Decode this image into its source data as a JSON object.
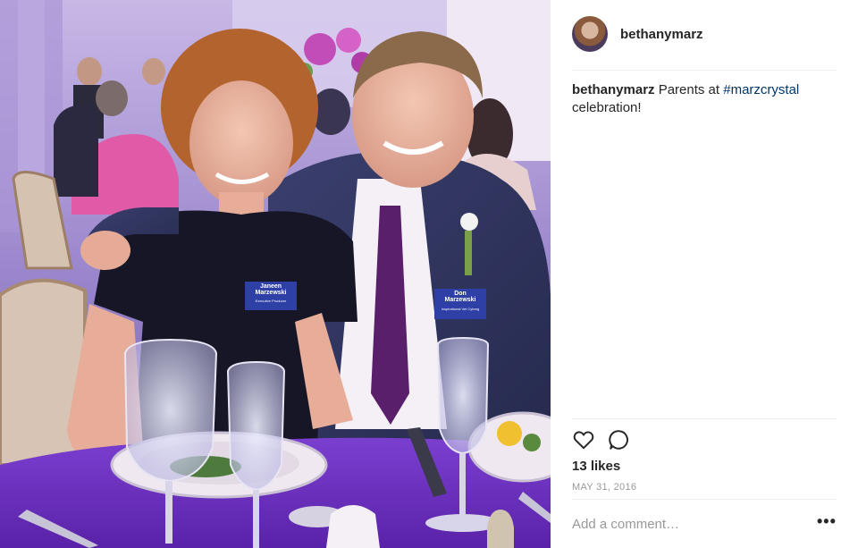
{
  "post": {
    "username": "bethanymarz",
    "caption": {
      "username": "bethanymarz",
      "text": " Parents at ",
      "hashtag": "#marzcrystal",
      "text_after": " celebration!"
    },
    "likes": "13 likes",
    "date": "MAY 31, 2016",
    "comment_placeholder": "Add a comment…",
    "more_label": "•••"
  },
  "photo": {
    "name_tag_left": {
      "line1": "Janeen",
      "line2": "Marzewski",
      "line3": "Executive Producer"
    },
    "name_tag_right": {
      "line1": "Don",
      "line2": "Marzewski",
      "line3": "Inspirational Vet Cyborg"
    }
  },
  "icons": {
    "like": "heart-icon",
    "comment": "comment-bubble-icon",
    "more": "more-options-icon"
  },
  "colors": {
    "hashtag": "#003569",
    "tablecloth": "#6a2fb8",
    "text": "#262626",
    "muted": "#999999"
  }
}
